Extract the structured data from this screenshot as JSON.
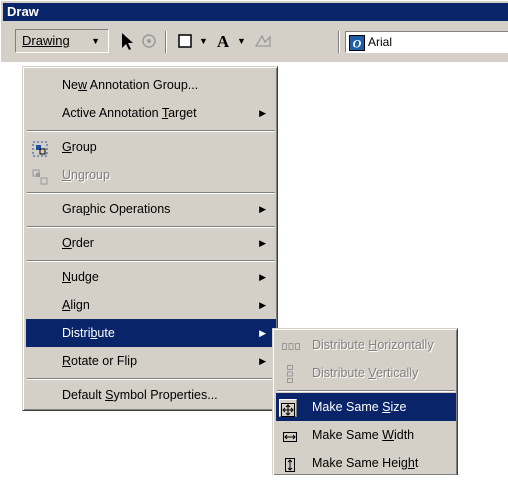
{
  "window": {
    "title": "Draw"
  },
  "toolbar": {
    "drawing_label": "Drawing",
    "font_name": "Arial",
    "icons": [
      "select-arrow-icon",
      "rotate-icon",
      "rectangle-icon",
      "text-A-icon",
      "edit-vertices-icon",
      "font-icon"
    ]
  },
  "menu": {
    "items": [
      {
        "label": "New Annotation Group...",
        "pre": "Ne",
        "ul": "w",
        "post": " Annotation Group..."
      },
      {
        "label": "Active Annotation Target",
        "pre": "Active Annotation ",
        "ul": "T",
        "post": "arget",
        "submenu": true
      },
      {
        "label": "Group",
        "pre": "",
        "ul": "G",
        "post": "roup",
        "icon": "group-icon"
      },
      {
        "label": "Ungroup",
        "pre": "",
        "ul": "U",
        "post": "ngroup",
        "icon": "ungroup-icon",
        "disabled": true
      },
      {
        "label": "Graphic Operations",
        "pre": "Gra",
        "ul": "p",
        "post": "hic Operations",
        "submenu": true
      },
      {
        "label": "Order",
        "pre": "",
        "ul": "O",
        "post": "rder",
        "submenu": true
      },
      {
        "label": "Nudge",
        "pre": "",
        "ul": "N",
        "post": "udge",
        "submenu": true
      },
      {
        "label": "Align",
        "pre": "",
        "ul": "A",
        "post": "lign",
        "submenu": true
      },
      {
        "label": "Distribute",
        "pre": "Distri",
        "ul": "b",
        "post": "ute",
        "submenu": true,
        "selected": true
      },
      {
        "label": "Rotate or Flip",
        "pre": "",
        "ul": "R",
        "post": "otate or Flip",
        "submenu": true
      },
      {
        "label": "Default Symbol Properties...",
        "pre": "Default ",
        "ul": "S",
        "post": "ymbol Properties..."
      }
    ]
  },
  "submenu": {
    "items": [
      {
        "label": "Distribute Horizontally",
        "pre": "Distribute ",
        "ul": "H",
        "post": "orizontally",
        "icon": "distribute-horizontally-icon",
        "disabled": true
      },
      {
        "label": "Distribute Vertically",
        "pre": "Distribute ",
        "ul": "V",
        "post": "ertically",
        "icon": "distribute-vertically-icon",
        "disabled": true
      },
      {
        "label": "Make Same Size",
        "pre": "Make Same ",
        "ul": "S",
        "post": "ize",
        "icon": "make-same-size-icon",
        "selected": true
      },
      {
        "label": "Make Same Width",
        "pre": "Make Same ",
        "ul": "W",
        "post": "idth",
        "icon": "make-same-width-icon"
      },
      {
        "label": "Make Same Height",
        "pre": "Make Same Heig",
        "ul": "h",
        "post": "t",
        "icon": "make-same-height-icon"
      }
    ]
  },
  "colors": {
    "face": "#d4d0c8",
    "highlight": "#0a246a",
    "disabled": "#808080"
  }
}
